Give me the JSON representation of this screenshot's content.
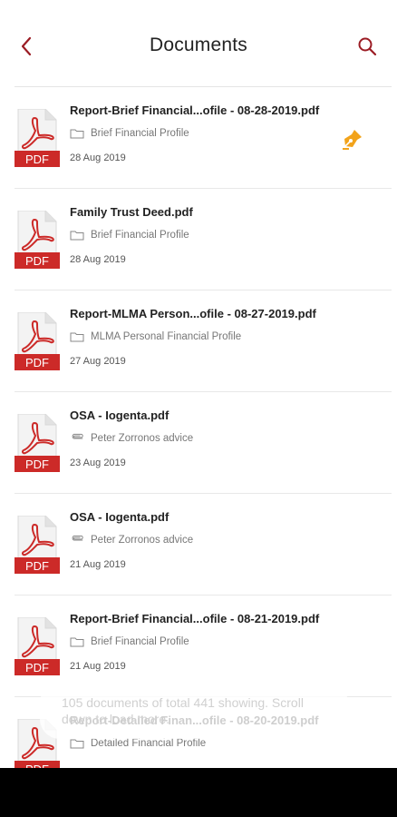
{
  "header": {
    "title": "Documents",
    "back_icon": "chevron-left-icon",
    "search_icon": "search-icon"
  },
  "colors": {
    "accent": "#9b1c24",
    "pdf_red": "#cc2a28",
    "sign_orange": "#f2a31b"
  },
  "documents": [
    {
      "name": "Report-Brief Financial...ofile - 08-28-2019.pdf",
      "type": "folder",
      "location": "Brief Financial Profile",
      "date": "28 Aug 2019",
      "signature_pending": true
    },
    {
      "name": "Family Trust Deed.pdf",
      "type": "folder",
      "location": "Brief Financial Profile",
      "date": "28 Aug 2019",
      "signature_pending": false
    },
    {
      "name": "Report-MLMA Person...ofile - 08-27-2019.pdf",
      "type": "folder",
      "location": "MLMA Personal Financial Profile",
      "date": "27 Aug 2019",
      "signature_pending": false
    },
    {
      "name": "OSA - Iogenta.pdf",
      "type": "attachment",
      "location": "Peter Zorronos advice",
      "date": "23 Aug 2019",
      "signature_pending": false
    },
    {
      "name": "OSA - Iogenta.pdf",
      "type": "attachment",
      "location": "Peter Zorronos advice",
      "date": "21 Aug 2019",
      "signature_pending": false
    },
    {
      "name": "Report-Brief Financial...ofile - 08-21-2019.pdf",
      "type": "folder",
      "location": "Brief Financial Profile",
      "date": "21 Aug 2019",
      "signature_pending": false
    },
    {
      "name": "Report-Detailed Finan...ofile - 08-20-2019.pdf",
      "type": "folder",
      "location": "Detailed Financial Profile",
      "date": "",
      "signature_pending": false
    }
  ],
  "pdf_label": "PDF",
  "toast": {
    "text": "105 documents of total 441 showing. Scroll down to load more."
  }
}
